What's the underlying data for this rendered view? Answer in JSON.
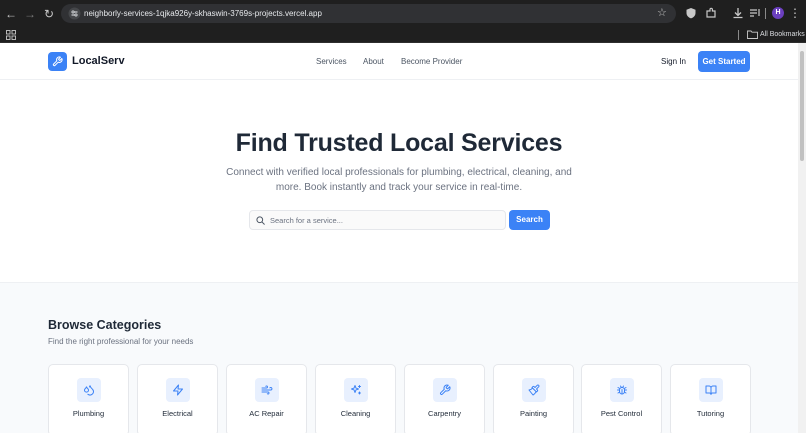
{
  "browser": {
    "url": "neighborly-services-1qjka926y-skhaswin-3769s-projects.vercel.app",
    "avatar_initial": "H",
    "bookmarks_label": "All Bookmarks"
  },
  "header": {
    "brand": "LocalServ",
    "nav": [
      "Services",
      "About",
      "Become Provider"
    ],
    "sign_in": "Sign In",
    "get_started": "Get Started"
  },
  "hero": {
    "title": "Find Trusted Local Services",
    "subtitle": "Connect with verified local professionals for plumbing, electrical, cleaning, and more. Book instantly and track your service in real-time.",
    "search_placeholder": "Search for a service...",
    "search_button": "Search"
  },
  "categories": {
    "title": "Browse Categories",
    "subtitle": "Find the right professional for your needs",
    "items": [
      {
        "label": "Plumbing",
        "icon": "droplets-icon"
      },
      {
        "label": "Electrical",
        "icon": "lightning-icon"
      },
      {
        "label": "AC Repair",
        "icon": "wind-icon"
      },
      {
        "label": "Cleaning",
        "icon": "sparkles-icon"
      },
      {
        "label": "Carpentry",
        "icon": "wrench-icon"
      },
      {
        "label": "Painting",
        "icon": "paintbrush-icon"
      },
      {
        "label": "Pest Control",
        "icon": "bug-icon"
      },
      {
        "label": "Tutoring",
        "icon": "book-icon"
      }
    ]
  },
  "colors": {
    "accent": "#3b82f6",
    "icon_bg": "#e8f0fe",
    "section_bg": "#f8fafc",
    "chrome_bg": "#1f1f1f"
  }
}
